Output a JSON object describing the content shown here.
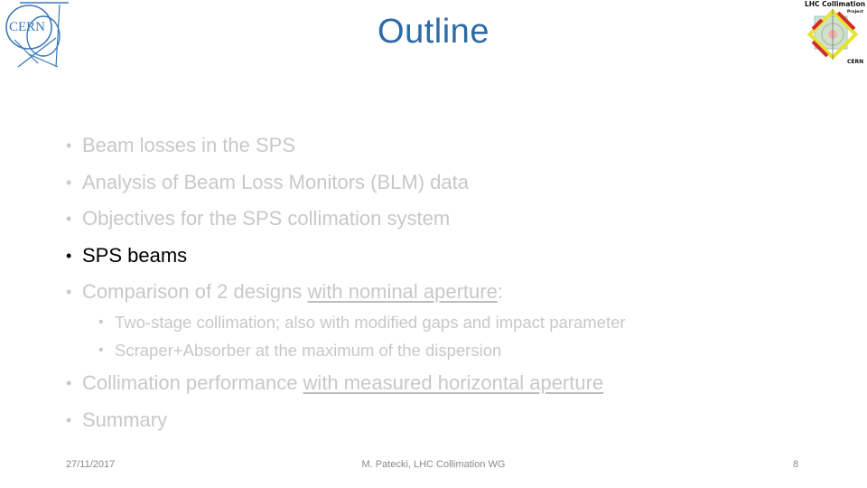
{
  "slide": {
    "title": "Outline",
    "logos": {
      "left": "CERN",
      "right_top": "LHC Collimation",
      "right_sub": "Project",
      "right_bottom": "CERN"
    },
    "bullets": [
      {
        "text": "Beam losses in the SPS",
        "active": false
      },
      {
        "text": "Analysis of Beam Loss Monitors (BLM) data",
        "active": false
      },
      {
        "text": "Objectives for the SPS collimation system",
        "active": false
      },
      {
        "text": "SPS beams",
        "active": true
      },
      {
        "text_before": "Comparison of 2 designs ",
        "text_underlined": "with nominal aperture",
        "text_after": ":",
        "active": false
      }
    ],
    "sub_bullets": [
      {
        "text": "Two-stage collimation; also with modified gaps and impact parameter"
      },
      {
        "text": "Scraper+Absorber at the maximum of the dispersion"
      }
    ],
    "bullets_after": [
      {
        "text_before": "Collimation performance ",
        "text_underlined": "with measured horizontal aperture",
        "active": false
      },
      {
        "text": "Summary",
        "active": false
      }
    ],
    "bullet_glyph": "•",
    "footer": {
      "date": "27/11/2017",
      "center": "M. Patecki, LHC Collimation WG",
      "page": "8"
    },
    "colors": {
      "title": "#2e6aa6",
      "active_text": "#000000",
      "inactive_text": "#c8c8c8"
    }
  }
}
